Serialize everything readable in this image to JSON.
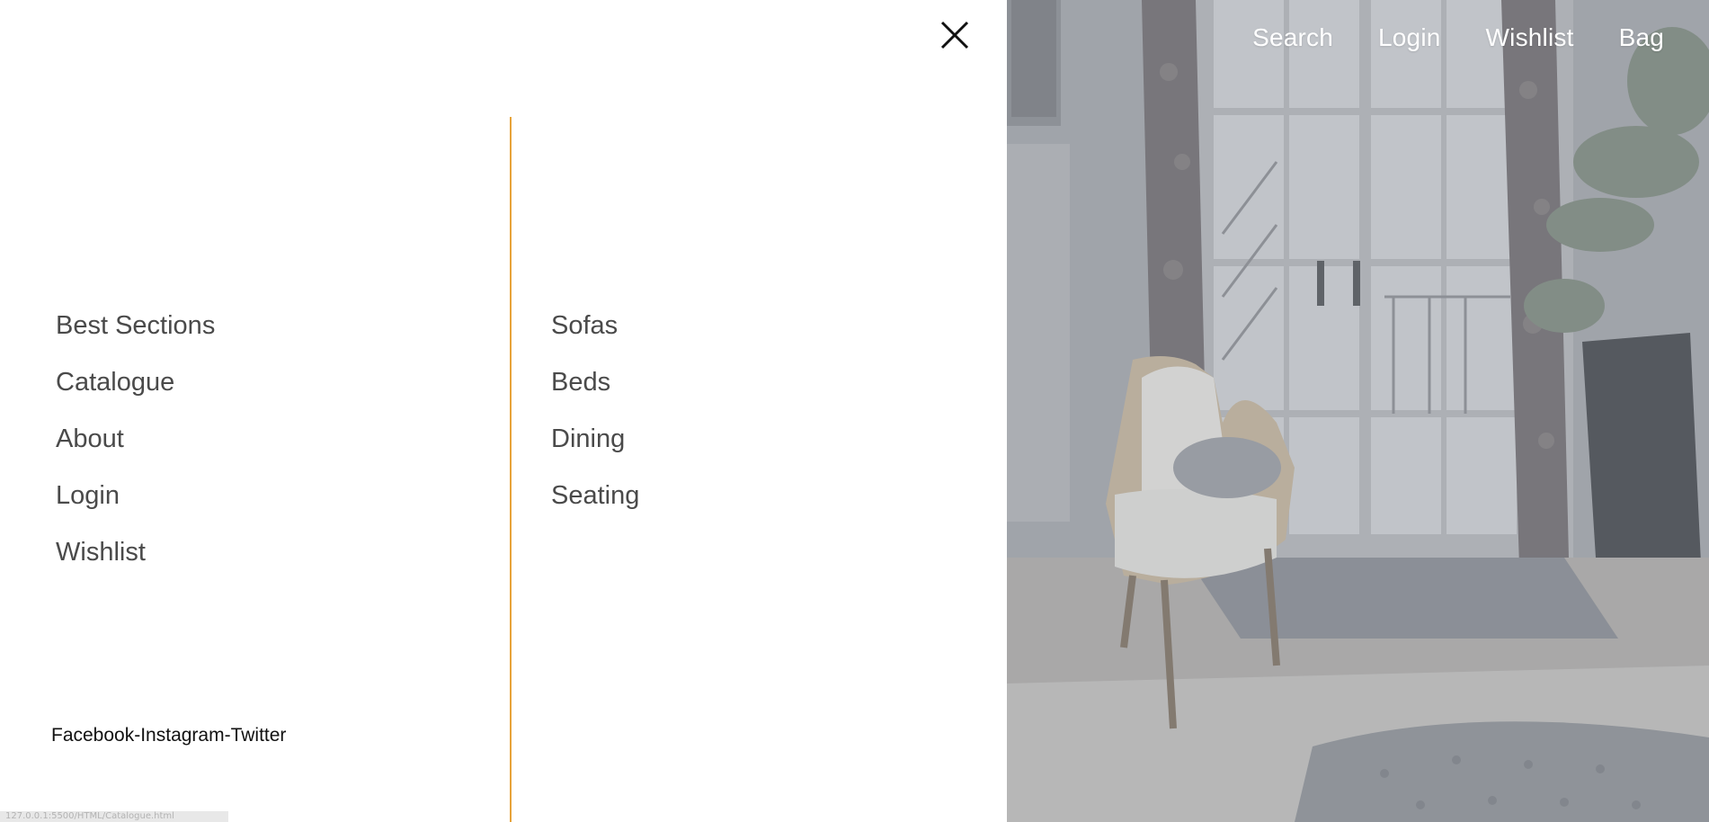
{
  "topnav": {
    "items": [
      {
        "label": "Search"
      },
      {
        "label": "Login"
      },
      {
        "label": "Wishlist"
      },
      {
        "label": "Bag"
      }
    ]
  },
  "panel": {
    "close_icon": "close-icon",
    "accent_color": "#e7a33a",
    "left_menu": [
      {
        "label": "Best Sections"
      },
      {
        "label": "Catalogue"
      },
      {
        "label": "About"
      },
      {
        "label": "Login"
      },
      {
        "label": "Wishlist"
      }
    ],
    "right_menu": [
      {
        "label": "Sofas"
      },
      {
        "label": "Beds"
      },
      {
        "label": "Dining"
      },
      {
        "label": "Seating"
      }
    ],
    "social_links": "Facebook-Instagram-Twitter"
  },
  "status_bar": {
    "url": "127.0.0.1:5500/HTML/Catalogue.html"
  }
}
